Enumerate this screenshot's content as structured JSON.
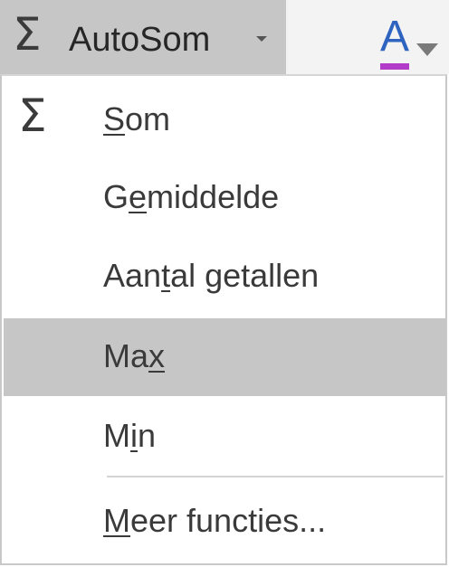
{
  "ribbon": {
    "autosum_label": "AutoSom",
    "autosum_icon": "sigma-icon",
    "fontcolor_icon": "font-color-icon",
    "fontcolor_letter": "A",
    "fontcolor_bar_color": "#b23cc8"
  },
  "menu": {
    "items": [
      {
        "pre": "",
        "ul": "S",
        "post": "om",
        "icon": "sigma-icon",
        "highlighted": false
      },
      {
        "pre": "G",
        "ul": "e",
        "post": "middelde",
        "highlighted": false
      },
      {
        "pre": "Aan",
        "ul": "t",
        "post": "al getallen",
        "highlighted": false
      },
      {
        "pre": "Ma",
        "ul": "x",
        "post": "",
        "highlighted": true
      },
      {
        "pre": "M",
        "ul": "i",
        "post": "n",
        "highlighted": false
      },
      {
        "pre": "",
        "ul": "M",
        "post": "eer functies...",
        "highlighted": false
      }
    ],
    "highlight_color": "#c6c6c6"
  }
}
